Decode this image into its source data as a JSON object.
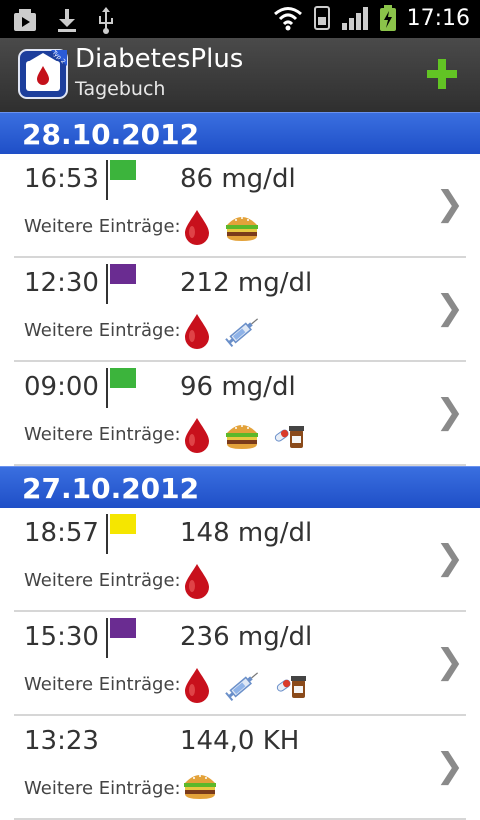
{
  "status_bar": {
    "time": "17:16"
  },
  "app": {
    "title": "DiabetesPlus",
    "subtitle": "Tagebuch",
    "icon_badge": "Typ 2"
  },
  "colors": {
    "flag_green": "#3cb43c",
    "flag_purple": "#6a2c91",
    "flag_yellow": "#f5e600",
    "header_blue": "#2a5bd7",
    "add_green": "#62c424"
  },
  "list": {
    "groups": [
      {
        "date": "28.10.2012",
        "entries": [
          {
            "time": "16:53",
            "flag": "green",
            "value": "86 mg/dl",
            "label": "Weitere Einträge:",
            "icons": [
              "blood-drop-icon",
              "burger-icon"
            ]
          },
          {
            "time": "12:30",
            "flag": "purple",
            "value": "212 mg/dl",
            "label": "Weitere Einträge:",
            "icons": [
              "blood-drop-icon",
              "syringe-icon"
            ]
          },
          {
            "time": "09:00",
            "flag": "green",
            "value": "96 mg/dl",
            "label": "Weitere Einträge:",
            "icons": [
              "blood-drop-icon",
              "burger-icon",
              "medication-icon"
            ]
          }
        ]
      },
      {
        "date": "27.10.2012",
        "entries": [
          {
            "time": "18:57",
            "flag": "yellow",
            "value": "148 mg/dl",
            "label": "Weitere Einträge:",
            "icons": [
              "blood-drop-icon"
            ]
          },
          {
            "time": "15:30",
            "flag": "purple",
            "value": "236 mg/dl",
            "label": "Weitere Einträge:",
            "icons": [
              "blood-drop-icon",
              "syringe-icon",
              "medication-icon"
            ]
          },
          {
            "time": "13:23",
            "flag": "none",
            "value": "144,0 KH",
            "label": "Weitere Einträge:",
            "icons": [
              "burger-icon"
            ]
          }
        ]
      }
    ]
  }
}
